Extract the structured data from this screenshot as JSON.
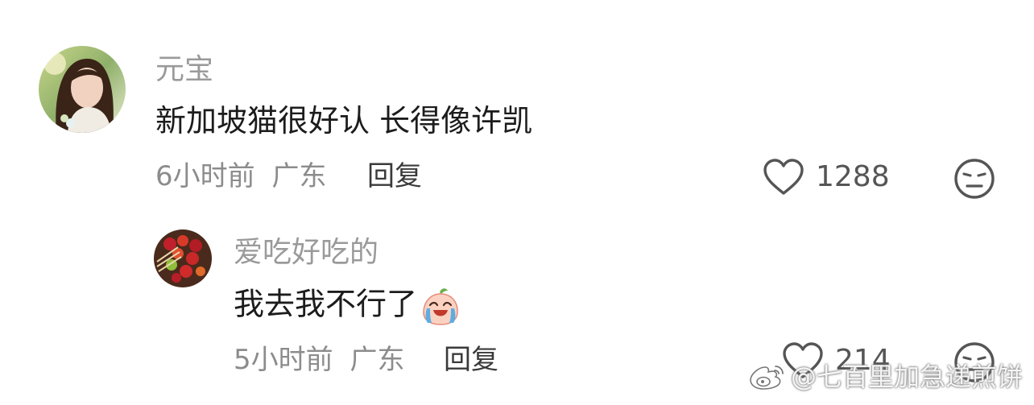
{
  "comments": [
    {
      "username": "元宝",
      "text": "新加坡猫很好认 长得像许凯",
      "time": "6小时前",
      "location": "广东",
      "reply_label": "回复",
      "likes": "1288"
    },
    {
      "username": "爱吃好吃的",
      "text": "我去我不行了",
      "emoji": "crying-laughing-peach-emoji",
      "time": "5小时前",
      "location": "广东",
      "reply_label": "回复",
      "likes": "214"
    }
  ],
  "watermark": {
    "text": "@七百里加急递煎饼",
    "icon": "weibo-logo"
  },
  "colors": {
    "username": "#9a9a9a",
    "text": "#1c1c1c",
    "meta": "#8c8c8c",
    "icon": "#555555"
  }
}
